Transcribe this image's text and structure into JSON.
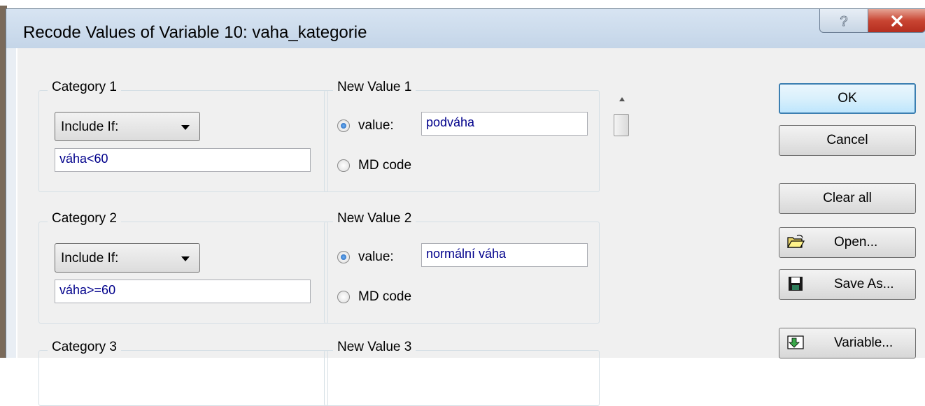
{
  "window": {
    "title": "Recode Values of Variable 10: vaha_kategorie"
  },
  "categories": [
    {
      "label": "Category 1",
      "condition_mode": "Include If:",
      "expression": "váha<60",
      "new_value_label": "New Value 1",
      "value_option": "value:",
      "value": "podváha",
      "md_option": "MD code"
    },
    {
      "label": "Category 2",
      "condition_mode": "Include If:",
      "expression": "váha>=60",
      "new_value_label": "New Value 2",
      "value_option": "value:",
      "value": "normální váha",
      "md_option": "MD code"
    },
    {
      "label": "Category 3",
      "new_value_label": "New Value 3"
    }
  ],
  "buttons": {
    "ok": "OK",
    "cancel": "Cancel",
    "clear_all": "Clear all",
    "open": "Open...",
    "save_as": "Save As...",
    "variable": "Variable..."
  },
  "colors": {
    "value_text": "#00008b",
    "close_button": "#c94532",
    "default_button_border": "#3c7fb1"
  }
}
